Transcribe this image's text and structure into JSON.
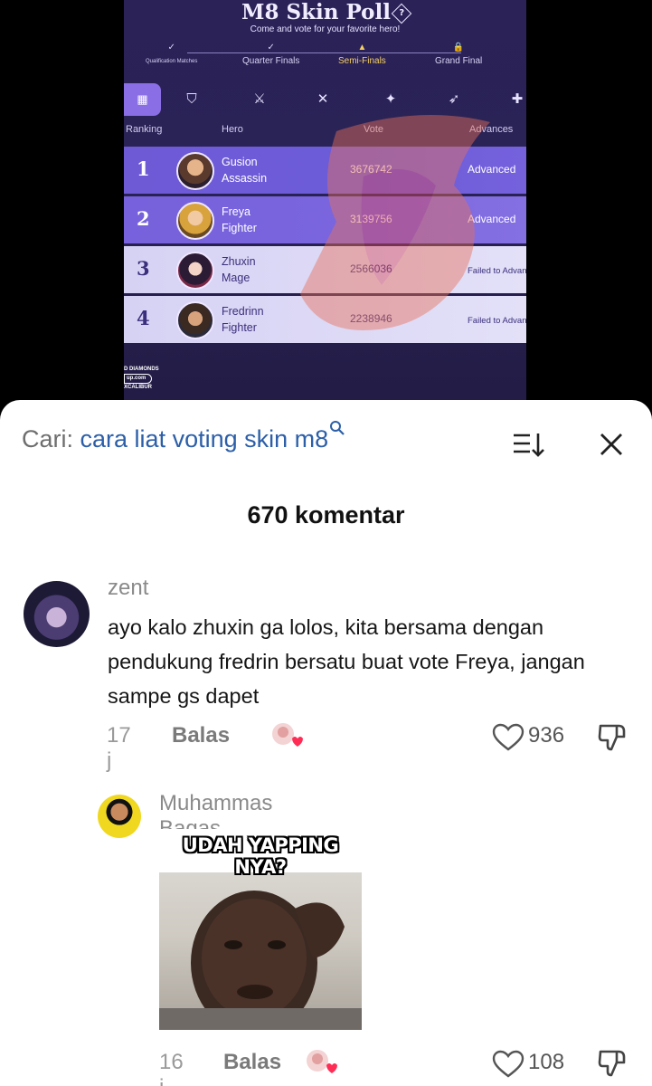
{
  "poll": {
    "title": "M8 Skin Poll",
    "help_glyph": "?",
    "subtitle": "Come and vote for your favorite hero!",
    "stages": [
      {
        "label": "Qualification Matches",
        "marker": "✓"
      },
      {
        "label": "Quarter Finals",
        "marker": "✓"
      },
      {
        "label": "Semi-Finals",
        "marker": "▲"
      },
      {
        "label": "Grand Final",
        "marker": "🔒"
      }
    ],
    "role_tabs": [
      "all-roles",
      "tank",
      "fighter",
      "assassin",
      "mage",
      "marksman",
      "support"
    ],
    "columns": {
      "ranking": "Ranking",
      "hero": "Hero",
      "vote": "Vote",
      "advances": "Advances"
    },
    "rows": [
      {
        "rank": "1",
        "name": "Gusion",
        "role": "Assassin",
        "vote": "3676742",
        "status": "Advanced"
      },
      {
        "rank": "2",
        "name": "Freya",
        "role": "Fighter",
        "vote": "3139756",
        "status": "Advanced"
      },
      {
        "rank": "3",
        "name": "Zhuxin",
        "role": "Mage",
        "vote": "2566036",
        "status": "Failed to Advanc"
      },
      {
        "rank": "4",
        "name": "Fredrinn",
        "role": "Fighter",
        "vote": "2238946",
        "status": "Failed to Advanc"
      }
    ],
    "footer_lines": [
      "D DIAMONDS",
      "up.com",
      "XCALIBUR"
    ]
  },
  "search": {
    "prefix": "Cari:",
    "query": "cara liat voting skin m8"
  },
  "comments_count": "670 komentar",
  "comments": [
    {
      "username": "zent",
      "text": "ayo kalo zhuxin ga lolos, kita bersama dengan pendukung fredrin bersatu buat vote Freya, jangan sampe gs dapet",
      "time": "17 j",
      "reply_label": "Balas",
      "likes": "936"
    },
    {
      "username": "Muhammas Bagas",
      "sticker_caption": "UDAH YAPPING NYA?",
      "time": "16 j",
      "reply_label": "Balas",
      "likes": "108"
    }
  ],
  "colors": {
    "accent_link": "#2c5fa8",
    "poll_bg": "#2a2356",
    "row_highlight": "#6f5ad6"
  }
}
